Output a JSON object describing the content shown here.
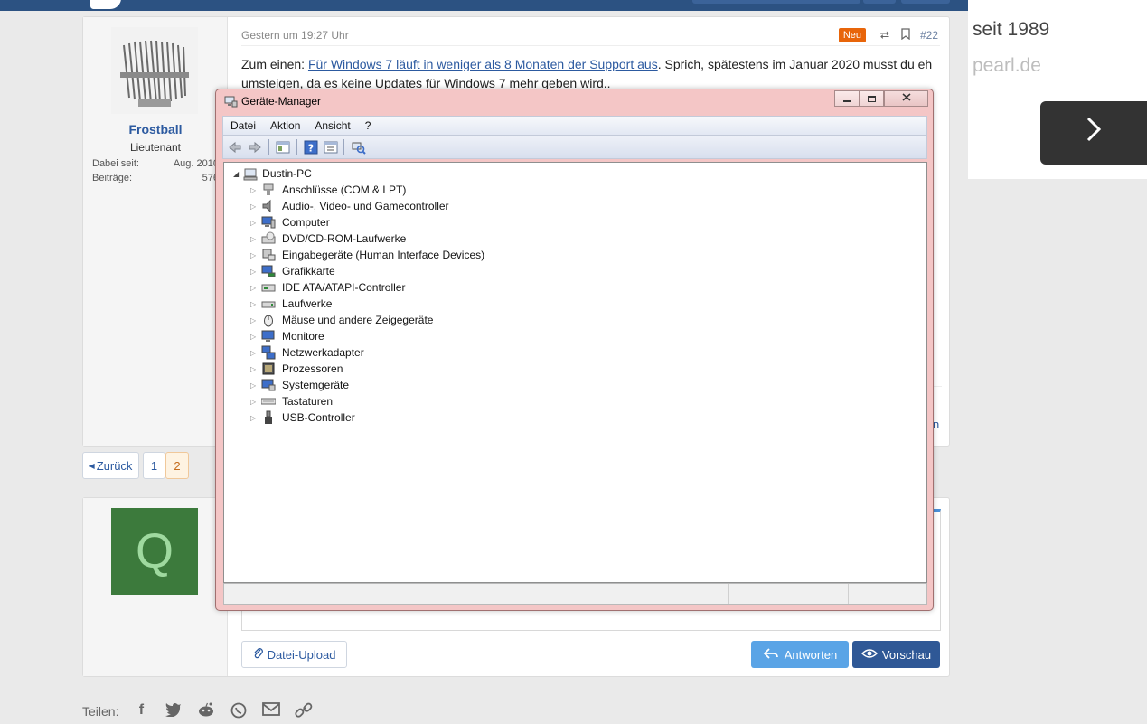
{
  "forum": {
    "post": {
      "user": {
        "name": "Frostball",
        "title": "Lieutenant",
        "stats": [
          {
            "label": "Dabei seit:",
            "value": "Aug. 2010"
          },
          {
            "label": "Beiträge:",
            "value": "576"
          }
        ]
      },
      "date": "Gestern um 19:27 Uhr",
      "new_badge": "Neu",
      "post_number": "#22",
      "body": {
        "intro": "Zum einen: ",
        "link_text": "Für Windows 7 läuft in weniger als 8 Monaten der Support aus",
        "rest": ". Sprich, spätestens im Januar 2020 musst du eh umsteigen, da es keine Updates für Windows 7 mehr geben wird.."
      },
      "right_fragment": "n"
    },
    "pagination": {
      "back_label": "Zurück",
      "pages": [
        "1",
        "2"
      ],
      "current": "2"
    },
    "reply": {
      "avatar_letter": "Q",
      "upload_label": "Datei-Upload",
      "answer_label": "Antworten",
      "preview_label": "Vorschau"
    },
    "share": {
      "label": "Teilen:",
      "icons": [
        "facebook-icon",
        "twitter-icon",
        "reddit-icon",
        "whatsapp-icon",
        "email-icon",
        "link-icon"
      ]
    }
  },
  "ad": {
    "line1": "seit 1989",
    "line2": "pearl.de"
  },
  "device_manager": {
    "title": "Geräte-Manager",
    "menu": [
      "Datei",
      "Aktion",
      "Ansicht",
      "?"
    ],
    "root": "Dustin-PC",
    "nodes": [
      {
        "label": "Anschlüsse (COM & LPT)",
        "icon": "port-icon"
      },
      {
        "label": "Audio-, Video- und Gamecontroller",
        "icon": "speaker-icon"
      },
      {
        "label": "Computer",
        "icon": "computer-icon"
      },
      {
        "label": "DVD/CD-ROM-Laufwerke",
        "icon": "cdrom-icon"
      },
      {
        "label": "Eingabegeräte (Human Interface Devices)",
        "icon": "hid-icon"
      },
      {
        "label": "Grafikkarte",
        "icon": "display-adapter-icon"
      },
      {
        "label": "IDE ATA/ATAPI-Controller",
        "icon": "ide-icon"
      },
      {
        "label": "Laufwerke",
        "icon": "disk-drive-icon"
      },
      {
        "label": "Mäuse und andere Zeigegeräte",
        "icon": "mouse-icon"
      },
      {
        "label": "Monitore",
        "icon": "monitor-icon"
      },
      {
        "label": "Netzwerkadapter",
        "icon": "network-icon"
      },
      {
        "label": "Prozessoren",
        "icon": "cpu-icon"
      },
      {
        "label": "Systemgeräte",
        "icon": "system-icon"
      },
      {
        "label": "Tastaturen",
        "icon": "keyboard-icon"
      },
      {
        "label": "USB-Controller",
        "icon": "usb-icon"
      }
    ]
  }
}
